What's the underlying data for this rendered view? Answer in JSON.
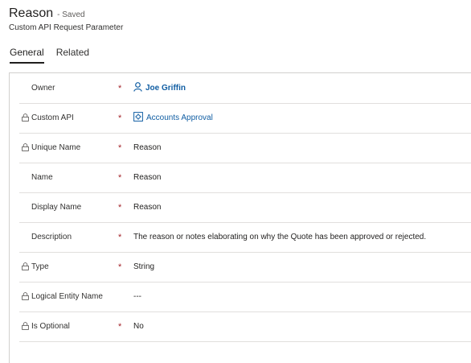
{
  "header": {
    "title": "Reason",
    "saved_status": "- Saved",
    "subtitle": "Custom API Request Parameter"
  },
  "tabs": [
    {
      "label": "General",
      "active": true
    },
    {
      "label": "Related",
      "active": false
    }
  ],
  "fields": [
    {
      "label": "Owner",
      "locked": false,
      "required": true,
      "value": "Joe Griffin",
      "value_icon": "person-icon",
      "value_style": "link"
    },
    {
      "label": "Custom API",
      "locked": true,
      "required": true,
      "value": "Accounts Approval",
      "value_icon": "entity-record-icon",
      "value_style": "link"
    },
    {
      "label": "Unique Name",
      "locked": true,
      "required": true,
      "value": "Reason"
    },
    {
      "label": "Name",
      "locked": false,
      "required": true,
      "value": "Reason"
    },
    {
      "label": "Display Name",
      "locked": false,
      "required": true,
      "value": "Reason"
    },
    {
      "label": "Description",
      "locked": false,
      "required": true,
      "value": "The reason or notes elaborating on why the Quote has been approved or rejected."
    },
    {
      "label": "Type",
      "locked": true,
      "required": true,
      "value": "String"
    },
    {
      "label": "Logical Entity Name",
      "locked": true,
      "required": false,
      "value": "---"
    },
    {
      "label": "Is Optional",
      "locked": true,
      "required": true,
      "value": "No"
    }
  ],
  "required_marker": "*",
  "colors": {
    "link": "#115ea3",
    "required": "#a4262c",
    "divider": "#e1dfdd"
  }
}
